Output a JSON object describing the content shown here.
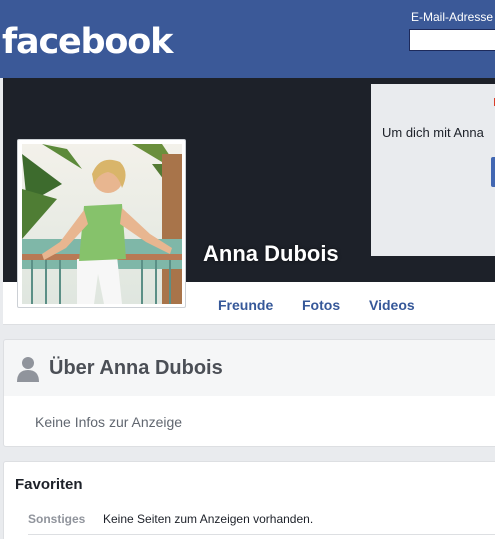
{
  "header": {
    "logo": "facebook",
    "email_label": "E-Mail-Adresse",
    "email_value": ""
  },
  "login_popup": {
    "text": "Um dich mit Anna"
  },
  "profile": {
    "name": "Anna Dubois"
  },
  "tabs": [
    {
      "label": "Freunde"
    },
    {
      "label": "Fotos"
    },
    {
      "label": "Videos"
    }
  ],
  "about": {
    "title": "Über Anna Dubois",
    "empty_text": "Keine Infos zur Anzeige"
  },
  "favorites": {
    "title": "Favoriten",
    "rows": [
      {
        "label": "Sonstiges",
        "value": "Keine Seiten zum Anzeigen vorhanden."
      }
    ]
  },
  "colors": {
    "brand_blue": "#3b5998",
    "link_blue": "#365899",
    "cover_dark": "#1d2129",
    "background": "#e9ebee"
  }
}
